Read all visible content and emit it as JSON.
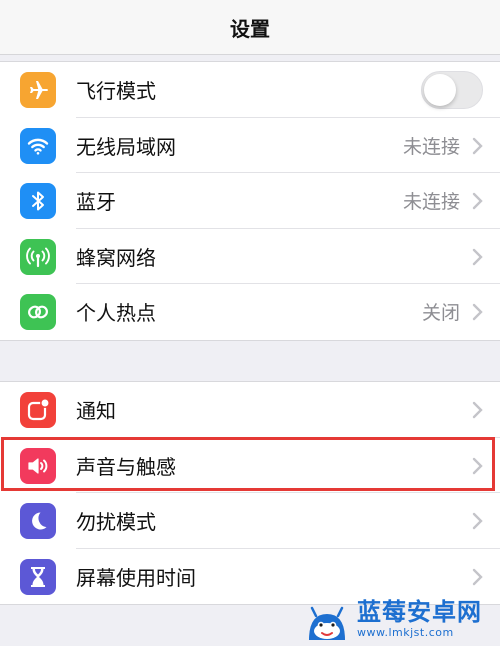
{
  "header": {
    "title": "设置"
  },
  "groups": [
    {
      "items": [
        {
          "label": "飞行模式",
          "icon": "airplane-icon",
          "color": "#f7a531",
          "control": "toggle",
          "toggle_on": false
        },
        {
          "label": "无线局域网",
          "icon": "wifi-icon",
          "color": "#1f8ff5",
          "value": "未连接"
        },
        {
          "label": "蓝牙",
          "icon": "bluetooth-icon",
          "color": "#1f8ff5",
          "value": "未连接"
        },
        {
          "label": "蜂窝网络",
          "icon": "cellular-antenna-icon",
          "color": "#3ec354"
        },
        {
          "label": "个人热点",
          "icon": "hotspot-link-icon",
          "color": "#3ec354",
          "value": "关闭"
        }
      ]
    },
    {
      "items": [
        {
          "label": "通知",
          "icon": "notifications-icon",
          "color": "#f2413a"
        },
        {
          "label": "声音与触感",
          "icon": "speaker-icon",
          "color": "#f23a5d",
          "highlighted": true
        },
        {
          "label": "勿扰模式",
          "icon": "moon-icon",
          "color": "#5c58d6"
        },
        {
          "label": "屏幕使用时间",
          "icon": "hourglass-icon",
          "color": "#5c58d6"
        }
      ]
    }
  ],
  "highlight_color": "#e53935",
  "watermark": {
    "name": "蓝莓安卓网",
    "url": "www.lmkjst.com",
    "logo": "robot-mascot-logo"
  }
}
